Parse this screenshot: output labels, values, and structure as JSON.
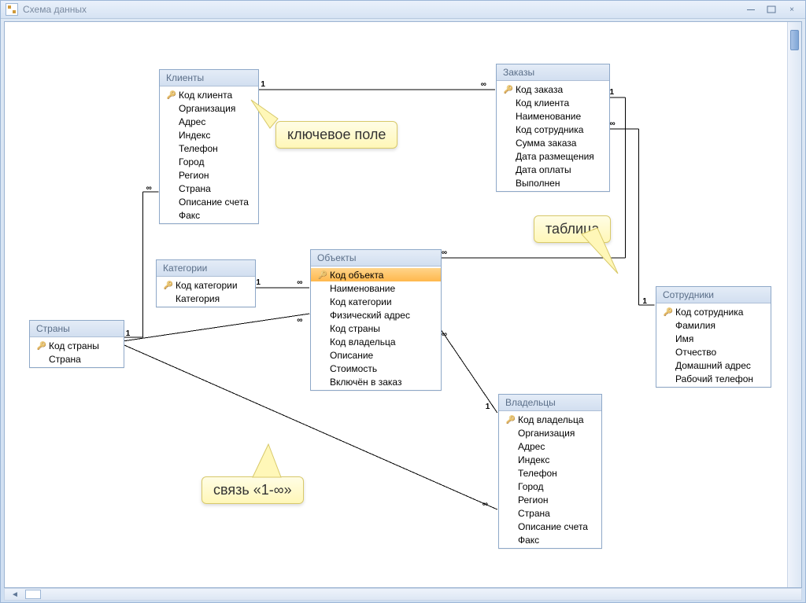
{
  "window": {
    "title": "Схема данных",
    "minimize_symbol": "—",
    "close_symbol": "×"
  },
  "entities": {
    "clients": {
      "title": "Клиенты",
      "fields": [
        {
          "key": true,
          "name": "Код клиента"
        },
        {
          "key": false,
          "name": "Организация"
        },
        {
          "key": false,
          "name": "Адрес"
        },
        {
          "key": false,
          "name": "Индекс"
        },
        {
          "key": false,
          "name": "Телефон"
        },
        {
          "key": false,
          "name": "Город"
        },
        {
          "key": false,
          "name": "Регион"
        },
        {
          "key": false,
          "name": "Страна"
        },
        {
          "key": false,
          "name": "Описание счета"
        },
        {
          "key": false,
          "name": "Факс"
        }
      ]
    },
    "orders": {
      "title": "Заказы",
      "fields": [
        {
          "key": true,
          "name": "Код заказа"
        },
        {
          "key": false,
          "name": "Код клиента"
        },
        {
          "key": false,
          "name": "Наименование"
        },
        {
          "key": false,
          "name": "Код сотрудника"
        },
        {
          "key": false,
          "name": "Сумма заказа"
        },
        {
          "key": false,
          "name": "Дата размещения"
        },
        {
          "key": false,
          "name": "Дата оплаты"
        },
        {
          "key": false,
          "name": "Выполнен"
        }
      ]
    },
    "categories": {
      "title": "Категории",
      "fields": [
        {
          "key": true,
          "name": "Код категории"
        },
        {
          "key": false,
          "name": "Категория"
        }
      ]
    },
    "objects": {
      "title": "Объекты",
      "fields": [
        {
          "key": true,
          "name": "Код объекта",
          "selected": true
        },
        {
          "key": false,
          "name": "Наименование"
        },
        {
          "key": false,
          "name": "Код категории"
        },
        {
          "key": false,
          "name": "Физический адрес"
        },
        {
          "key": false,
          "name": "Код страны"
        },
        {
          "key": false,
          "name": "Код владельца"
        },
        {
          "key": false,
          "name": "Описание"
        },
        {
          "key": false,
          "name": "Стоимость"
        },
        {
          "key": false,
          "name": "Включён в заказ"
        }
      ]
    },
    "countries": {
      "title": "Страны",
      "fields": [
        {
          "key": true,
          "name": "Код страны"
        },
        {
          "key": false,
          "name": "Страна"
        }
      ]
    },
    "owners": {
      "title": "Владельцы",
      "fields": [
        {
          "key": true,
          "name": "Код владельца"
        },
        {
          "key": false,
          "name": "Организация"
        },
        {
          "key": false,
          "name": "Адрес"
        },
        {
          "key": false,
          "name": "Индекс"
        },
        {
          "key": false,
          "name": "Телефон"
        },
        {
          "key": false,
          "name": "Город"
        },
        {
          "key": false,
          "name": "Регион"
        },
        {
          "key": false,
          "name": "Страна"
        },
        {
          "key": false,
          "name": "Описание счета"
        },
        {
          "key": false,
          "name": "Факс"
        }
      ]
    },
    "employees": {
      "title": "Сотрудники",
      "fields": [
        {
          "key": true,
          "name": "Код сотрудника"
        },
        {
          "key": false,
          "name": "Фамилия"
        },
        {
          "key": false,
          "name": "Имя"
        },
        {
          "key": false,
          "name": "Отчество"
        },
        {
          "key": false,
          "name": "Домашний адрес"
        },
        {
          "key": false,
          "name": "Рабочий телефон"
        }
      ]
    }
  },
  "callouts": {
    "key_field": "ключевое поле",
    "table": "таблица",
    "relation": "связь «1-∞»"
  },
  "relationships": [
    {
      "from": "clients",
      "to": "orders",
      "card_from": "1",
      "card_to": "∞"
    },
    {
      "from": "orders",
      "to": "objects",
      "card_from": "1",
      "card_to": "∞"
    },
    {
      "from": "orders",
      "to": "employees",
      "card_from": "∞",
      "card_to": "1"
    },
    {
      "from": "categories",
      "to": "objects",
      "card_from": "1",
      "card_to": "∞"
    },
    {
      "from": "countries",
      "to": "clients",
      "card_from": "1",
      "card_to": "∞"
    },
    {
      "from": "countries",
      "to": "objects",
      "card_from": "1",
      "card_to": "∞"
    },
    {
      "from": "countries",
      "to": "owners",
      "card_from": "1",
      "card_to": "∞"
    },
    {
      "from": "objects",
      "to": "owners",
      "card_from": "∞",
      "card_to": "1"
    }
  ],
  "chart_data": {
    "type": "table",
    "description": "Entity-relationship diagram (Access 'Схема данных') with 7 tables and 8 one-to-many relationships.",
    "tables": [
      "Клиенты",
      "Заказы",
      "Категории",
      "Объекты",
      "Страны",
      "Владельцы",
      "Сотрудники"
    ],
    "relationships": [
      {
        "one": "Клиенты",
        "many": "Заказы"
      },
      {
        "one": "Заказы",
        "many": "Объекты"
      },
      {
        "one": "Сотрудники",
        "many": "Заказы"
      },
      {
        "one": "Категории",
        "many": "Объекты"
      },
      {
        "one": "Страны",
        "many": "Клиенты"
      },
      {
        "one": "Страны",
        "many": "Объекты"
      },
      {
        "one": "Страны",
        "many": "Владельцы"
      },
      {
        "one": "Владельцы",
        "many": "Объекты"
      }
    ]
  }
}
